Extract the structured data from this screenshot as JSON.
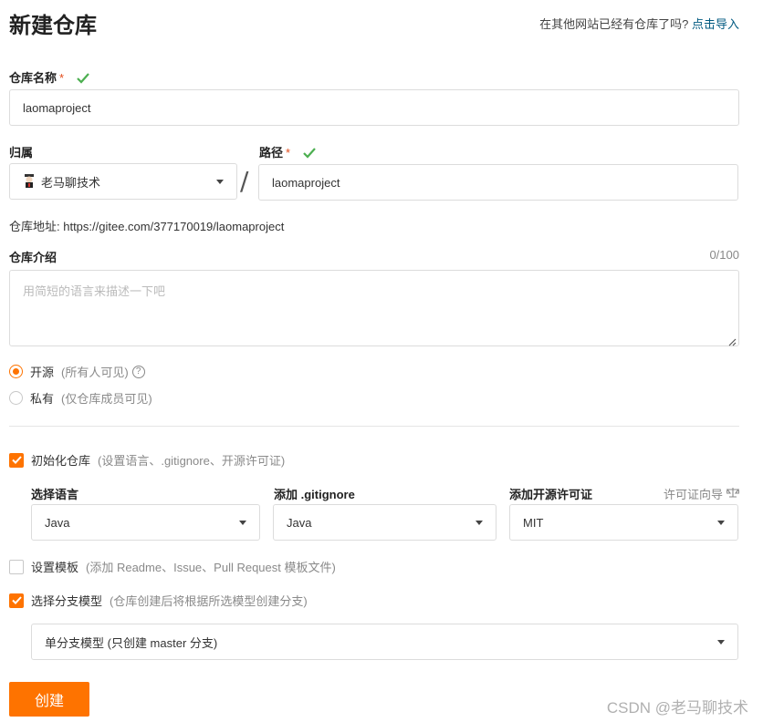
{
  "page": {
    "title": "新建仓库",
    "import_hint": "在其他网站已经有仓库了吗?",
    "import_link": "点击导入"
  },
  "repo_name": {
    "label": "仓库名称",
    "required": "*",
    "value": "laomaproject"
  },
  "owner": {
    "label": "归属",
    "value": "老马聊技术"
  },
  "path": {
    "separator": "/",
    "label": "路径",
    "required": "*",
    "value": "laomaproject"
  },
  "address": {
    "text": "仓库地址: https://gitee.com/377170019/laomaproject"
  },
  "description": {
    "label": "仓库介绍",
    "counter": "0/100",
    "placeholder": "用简短的语言来描述一下吧"
  },
  "visibility": {
    "options": [
      {
        "label": "开源",
        "hint": "(所有人可见)",
        "selected": true,
        "help_icon": "?"
      },
      {
        "label": "私有",
        "hint": "(仅仓库成员可见)",
        "selected": false
      }
    ]
  },
  "init_repo": {
    "checked": true,
    "label": "初始化仓库",
    "hint": "(设置语言、.gitignore、开源许可证)"
  },
  "language": {
    "label": "选择语言",
    "value": "Java"
  },
  "gitignore": {
    "label": "添加 .gitignore",
    "value": "Java"
  },
  "license": {
    "label": "添加开源许可证",
    "value": "MIT",
    "guide": "许可证向导"
  },
  "template": {
    "checked": false,
    "label": "设置模板",
    "hint": "(添加 Readme、Issue、Pull Request 模板文件)"
  },
  "branch_model": {
    "checked": true,
    "label": "选择分支模型",
    "hint": "(仓库创建后将根据所选模型创建分支)",
    "value": "单分支模型 (只创建 master 分支)"
  },
  "actions": {
    "create": "创建"
  },
  "watermark": "CSDN @老马聊技术",
  "colors": {
    "accent": "#fe7300",
    "link": "#005980",
    "success": "#4caf50",
    "required": "#e34d1c"
  },
  "icons": [
    "check-icon",
    "caret-down-icon",
    "help-circle-icon",
    "scale-icon",
    "avatar-icon",
    "checkbox-check-icon"
  ]
}
